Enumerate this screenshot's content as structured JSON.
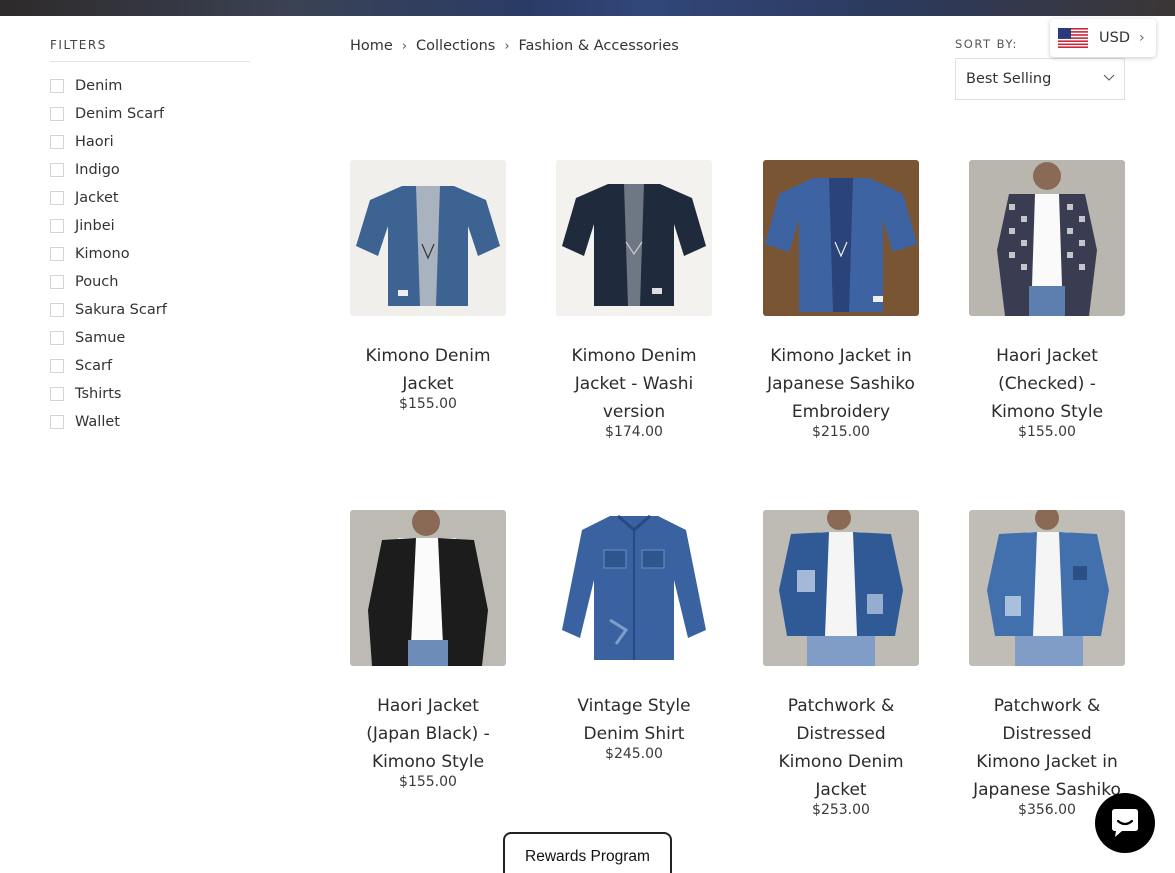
{
  "filters": {
    "title": "FILTERS",
    "items": [
      "Denim",
      "Denim Scarf",
      "Haori",
      "Indigo",
      "Jacket",
      "Jinbei",
      "Kimono",
      "Pouch",
      "Sakura Scarf",
      "Samue",
      "Scarf",
      "Tshirts",
      "Wallet"
    ]
  },
  "breadcrumb": {
    "home": "Home",
    "collections": "Collections",
    "current": "Fashion & Accessories",
    "separator": "›"
  },
  "sort": {
    "label": "SORT BY:",
    "selected": "Best Selling"
  },
  "currency": {
    "code": "USD",
    "flag": "us-flag-icon"
  },
  "products": [
    {
      "title": "Kimono Denim Jacket",
      "price": "$155.00",
      "image": "denim-kimono-jacket"
    },
    {
      "title": "Kimono Denim Jacket - Washi version",
      "price": "$174.00",
      "image": "dark-denim-kimono-jacket"
    },
    {
      "title": "Kimono Jacket in Japanese Sashiko Embroidery",
      "price": "$215.00",
      "image": "sashiko-kimono-jacket"
    },
    {
      "title": "Haori Jacket (Checked) - Kimono Style",
      "price": "$155.00",
      "image": "checked-haori-model"
    },
    {
      "title": "Haori Jacket (Japan Black) - Kimono Style",
      "price": "$155.00",
      "image": "black-haori-model"
    },
    {
      "title": "Vintage Style Denim Shirt",
      "price": "$245.00",
      "image": "vintage-denim-shirt"
    },
    {
      "title": "Patchwork & Distressed Kimono Denim Jacket",
      "price": "$253.00",
      "image": "patchwork-denim-model"
    },
    {
      "title": "Patchwork & Distressed Kimono Jacket in Japanese Sashiko",
      "price": "$356.00",
      "image": "patchwork-sashiko-model"
    }
  ],
  "rewards": {
    "label": "Rewards Program"
  },
  "chat": {
    "icon": "chat-bubble-icon"
  }
}
